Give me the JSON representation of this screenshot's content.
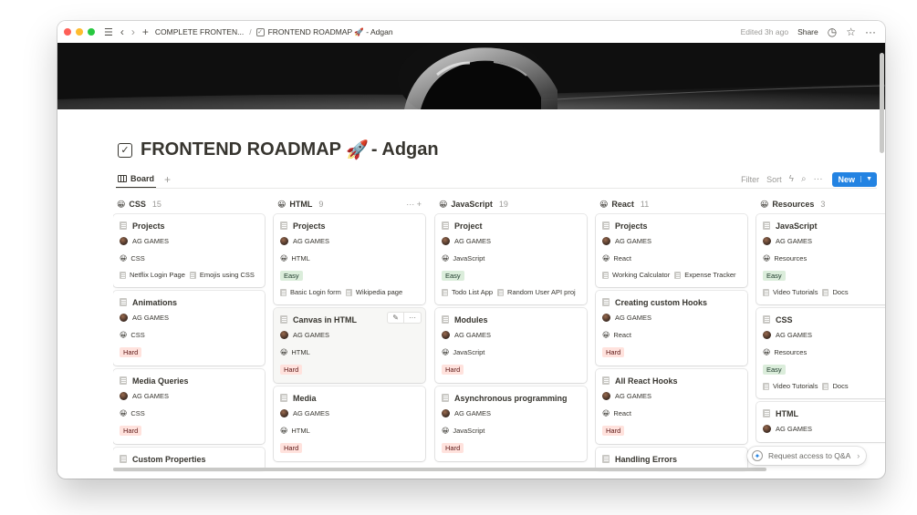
{
  "titlebar": {
    "breadcrumb_parent": "COMPLETE FRONTEN...",
    "breadcrumb_sep": "/",
    "breadcrumb_current": "FRONTEND ROADMAP 🚀 - Adgan",
    "edited": "Edited 3h ago",
    "share": "Share",
    "icons": [
      "menu-icon",
      "back-icon",
      "forward-icon",
      "plus-icon",
      "clock-icon",
      "star-icon",
      "more-icon"
    ]
  },
  "page": {
    "title_main": "FRONTEND ROADMAP",
    "title_emoji": "🚀",
    "title_suffix": "- Adgan"
  },
  "viewbar": {
    "tab_label": "Board",
    "filter": "Filter",
    "sort": "Sort",
    "new_label": "New"
  },
  "columns": [
    {
      "emoji": "😀",
      "name": "CSS",
      "count": "15",
      "cards": [
        {
          "title": "Projects",
          "author": "AG GAMES",
          "category": "CSS",
          "links": [
            "Netflix Login Page",
            "Emojis using CSS"
          ]
        },
        {
          "title": "Animations",
          "author": "AG GAMES",
          "category": "CSS",
          "difficulty": "Hard"
        },
        {
          "title": "Media Queries",
          "author": "AG GAMES",
          "category": "CSS",
          "difficulty": "Hard"
        },
        {
          "title": "Custom Properties"
        }
      ]
    },
    {
      "emoji": "😀",
      "name": "HTML",
      "count": "9",
      "cards": [
        {
          "title": "Projects",
          "author": "AG GAMES",
          "category": "HTML",
          "difficulty": "Easy",
          "links": [
            "Basic Login form",
            "Wikipedia page"
          ]
        },
        {
          "title": "Canvas in HTML",
          "author": "AG GAMES",
          "category": "HTML",
          "difficulty": "Hard"
        },
        {
          "title": "Media",
          "author": "AG GAMES",
          "category": "HTML",
          "difficulty": "Hard"
        }
      ]
    },
    {
      "emoji": "😀",
      "name": "JavaScript",
      "count": "19",
      "cards": [
        {
          "title": "Project",
          "author": "AG GAMES",
          "category": "JavaScript",
          "difficulty": "Easy",
          "links": [
            "Todo List App",
            "Random User API proj"
          ]
        },
        {
          "title": "Modules",
          "author": "AG GAMES",
          "category": "JavaScript",
          "difficulty": "Hard"
        },
        {
          "title": "Asynchronous programming",
          "author": "AG GAMES",
          "category": "JavaScript",
          "difficulty": "Hard"
        }
      ]
    },
    {
      "emoji": "😀",
      "name": "React",
      "count": "11",
      "cards": [
        {
          "title": "Projects",
          "author": "AG GAMES",
          "category": "React",
          "links": [
            "Working Calculator",
            "Expense Tracker"
          ]
        },
        {
          "title": "Creating custom Hooks",
          "author": "AG GAMES",
          "category": "React",
          "difficulty": "Hard"
        },
        {
          "title": "All React Hooks",
          "author": "AG GAMES",
          "category": "React",
          "difficulty": "Hard"
        },
        {
          "title": "Handling Errors"
        }
      ]
    },
    {
      "emoji": "😀",
      "name": "Resources",
      "count": "3",
      "cards": [
        {
          "title": "JavaScript",
          "author": "AG GAMES",
          "category": "Resources",
          "difficulty": "Easy",
          "links": [
            "Video Tutorials",
            "Docs"
          ]
        },
        {
          "title": "CSS",
          "author": "AG GAMES",
          "category": "Resources",
          "difficulty": "Easy",
          "links": [
            "Video Tutorials",
            "Docs"
          ]
        },
        {
          "title": "HTML",
          "author": "AG GAMES"
        }
      ]
    }
  ],
  "qa_button": "Request access to Q&A",
  "colors": {
    "accent": "#2383e2",
    "tag_easy_bg": "#dbeddb",
    "tag_hard_bg": "#ffe2dd"
  }
}
